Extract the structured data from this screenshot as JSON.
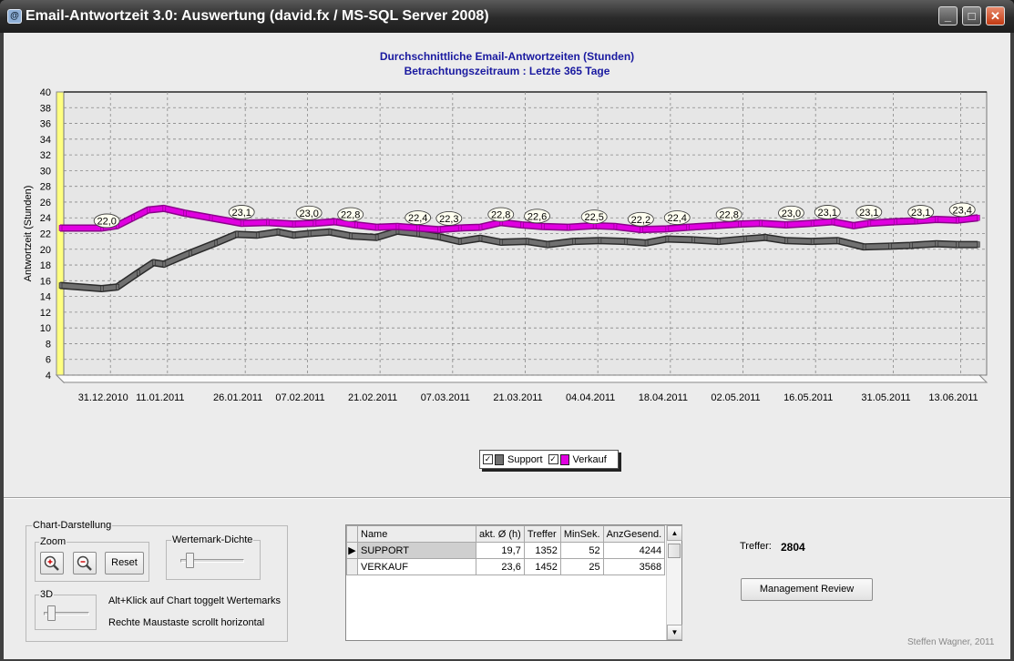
{
  "window": {
    "title": "Email-Antwortzeit 3.0: Auswertung (david.fx / MS-SQL Server 2008)",
    "controls": {
      "minimize": "_",
      "maximize": "□",
      "close": "✕"
    }
  },
  "chart_data": {
    "type": "line",
    "title": "Durchschnittliche Email-Antwortzeiten (Stunden)",
    "subtitle": "Betrachtungszeitraum : Letzte 365 Tage",
    "ylabel": "Antwortzeit (Stunden)",
    "ylim": [
      4,
      40
    ],
    "yticks": [
      4,
      6,
      8,
      10,
      12,
      14,
      16,
      18,
      20,
      22,
      24,
      26,
      28,
      30,
      32,
      34,
      36,
      38,
      40
    ],
    "xlim": [
      "2010-12-22",
      "2011-06-18"
    ],
    "xticks": [
      {
        "date": "2010-12-31",
        "label": "31.12.2010"
      },
      {
        "date": "2011-01-11",
        "label": "11.01.2011"
      },
      {
        "date": "2011-01-26",
        "label": "26.01.2011"
      },
      {
        "date": "2011-02-07",
        "label": "07.02.2011"
      },
      {
        "date": "2011-02-21",
        "label": "21.02.2011"
      },
      {
        "date": "2011-03-07",
        "label": "07.03.2011"
      },
      {
        "date": "2011-03-21",
        "label": "21.03.2011"
      },
      {
        "date": "2011-04-04",
        "label": "04.04.2011"
      },
      {
        "date": "2011-04-18",
        "label": "18.04.2011"
      },
      {
        "date": "2011-05-02",
        "label": "02.05.2011"
      },
      {
        "date": "2011-05-16",
        "label": "16.05.2011"
      },
      {
        "date": "2011-05-31",
        "label": "31.05.2011"
      },
      {
        "date": "2011-06-13",
        "label": "13.06.2011"
      }
    ],
    "grid": true,
    "legend_position": "bottom-center",
    "series": [
      {
        "name": "Support",
        "color": "#707070",
        "points": [
          [
            "2010-12-22",
            15.4
          ],
          [
            "2010-12-30",
            15.0
          ],
          [
            "2011-01-02",
            15.2
          ],
          [
            "2011-01-06",
            17.0
          ],
          [
            "2011-01-09",
            18.3
          ],
          [
            "2011-01-11",
            18.1
          ],
          [
            "2011-01-16",
            19.5
          ],
          [
            "2011-01-21",
            20.8
          ],
          [
            "2011-01-25",
            21.9
          ],
          [
            "2011-01-29",
            21.8
          ],
          [
            "2011-02-02",
            22.2
          ],
          [
            "2011-02-05",
            21.8
          ],
          [
            "2011-02-08",
            22.0
          ],
          [
            "2011-02-12",
            22.2
          ],
          [
            "2011-02-16",
            21.7
          ],
          [
            "2011-02-21",
            21.5
          ],
          [
            "2011-02-25",
            22.3
          ],
          [
            "2011-03-01",
            22.0
          ],
          [
            "2011-03-05",
            21.6
          ],
          [
            "2011-03-09",
            21.0
          ],
          [
            "2011-03-13",
            21.4
          ],
          [
            "2011-03-17",
            20.9
          ],
          [
            "2011-03-22",
            21.0
          ],
          [
            "2011-03-26",
            20.6
          ],
          [
            "2011-03-31",
            21.0
          ],
          [
            "2011-04-05",
            21.1
          ],
          [
            "2011-04-10",
            21.0
          ],
          [
            "2011-04-14",
            20.8
          ],
          [
            "2011-04-18",
            21.3
          ],
          [
            "2011-04-23",
            21.2
          ],
          [
            "2011-04-28",
            21.0
          ],
          [
            "2011-05-03",
            21.3
          ],
          [
            "2011-05-07",
            21.5
          ],
          [
            "2011-05-11",
            21.1
          ],
          [
            "2011-05-16",
            21.0
          ],
          [
            "2011-05-21",
            21.1
          ],
          [
            "2011-05-26",
            20.3
          ],
          [
            "2011-05-31",
            20.4
          ],
          [
            "2011-06-04",
            20.5
          ],
          [
            "2011-06-09",
            20.7
          ],
          [
            "2011-06-13",
            20.6
          ],
          [
            "2011-06-17",
            20.6
          ]
        ]
      },
      {
        "name": "Verkauf",
        "color": "#e000e0",
        "points": [
          [
            "2010-12-22",
            22.7
          ],
          [
            "2010-12-30",
            22.7
          ],
          [
            "2011-01-02",
            23.0
          ],
          [
            "2011-01-05",
            24.0
          ],
          [
            "2011-01-08",
            25.0
          ],
          [
            "2011-01-11",
            25.2
          ],
          [
            "2011-01-15",
            24.6
          ],
          [
            "2011-01-20",
            24.0
          ],
          [
            "2011-01-26",
            23.3
          ],
          [
            "2011-01-31",
            23.4
          ],
          [
            "2011-02-05",
            23.2
          ],
          [
            "2011-02-09",
            23.3
          ],
          [
            "2011-02-13",
            23.5
          ],
          [
            "2011-02-17",
            23.1
          ],
          [
            "2011-02-21",
            22.8
          ],
          [
            "2011-02-25",
            22.9
          ],
          [
            "2011-03-01",
            22.7
          ],
          [
            "2011-03-05",
            22.5
          ],
          [
            "2011-03-09",
            22.7
          ],
          [
            "2011-03-13",
            22.8
          ],
          [
            "2011-03-17",
            23.4
          ],
          [
            "2011-03-21",
            23.1
          ],
          [
            "2011-03-25",
            22.9
          ],
          [
            "2011-03-30",
            22.8
          ],
          [
            "2011-04-04",
            23.0
          ],
          [
            "2011-04-08",
            22.9
          ],
          [
            "2011-04-13",
            22.5
          ],
          [
            "2011-04-18",
            22.6
          ],
          [
            "2011-04-22",
            22.8
          ],
          [
            "2011-04-27",
            23.0
          ],
          [
            "2011-05-02",
            23.2
          ],
          [
            "2011-05-06",
            23.3
          ],
          [
            "2011-05-11",
            23.1
          ],
          [
            "2011-05-16",
            23.3
          ],
          [
            "2011-05-20",
            23.5
          ],
          [
            "2011-05-24",
            23.0
          ],
          [
            "2011-05-27",
            23.3
          ],
          [
            "2011-06-01",
            23.5
          ],
          [
            "2011-06-05",
            23.6
          ],
          [
            "2011-06-09",
            23.8
          ],
          [
            "2011-06-13",
            23.7
          ],
          [
            "2011-06-17",
            24.0
          ]
        ]
      }
    ],
    "annotations": [
      {
        "date": "2010-12-31",
        "value": 22.0,
        "label": "22,0"
      },
      {
        "date": "2011-01-26",
        "value": 23.1,
        "label": "23,1"
      },
      {
        "date": "2011-02-08",
        "value": 23.0,
        "label": "23,0"
      },
      {
        "date": "2011-02-16",
        "value": 22.8,
        "label": "22,8"
      },
      {
        "date": "2011-03-01",
        "value": 22.4,
        "label": "22,4"
      },
      {
        "date": "2011-03-07",
        "value": 22.3,
        "label": "22,3"
      },
      {
        "date": "2011-03-17",
        "value": 22.8,
        "label": "22,8"
      },
      {
        "date": "2011-03-24",
        "value": 22.6,
        "label": "22,6"
      },
      {
        "date": "2011-04-04",
        "value": 22.5,
        "label": "22,5"
      },
      {
        "date": "2011-04-13",
        "value": 22.2,
        "label": "22,2"
      },
      {
        "date": "2011-04-20",
        "value": 22.4,
        "label": "22,4"
      },
      {
        "date": "2011-04-30",
        "value": 22.8,
        "label": "22,8"
      },
      {
        "date": "2011-05-12",
        "value": 23.0,
        "label": "23,0"
      },
      {
        "date": "2011-05-19",
        "value": 23.1,
        "label": "23,1"
      },
      {
        "date": "2011-05-27",
        "value": 23.1,
        "label": "23,1"
      },
      {
        "date": "2011-06-06",
        "value": 23.1,
        "label": "23,1"
      },
      {
        "date": "2011-06-14",
        "value": 23.4,
        "label": "23,4"
      }
    ]
  },
  "legend": {
    "items": [
      {
        "label": "Support",
        "color": "#707070",
        "checked": "✓"
      },
      {
        "label": "Verkauf",
        "color": "#e000e0",
        "checked": "✓"
      }
    ]
  },
  "controls": {
    "chart_group": "Chart-Darstellung",
    "zoom_group": "Zoom",
    "zoom_in_icon": "zoom-in-icon",
    "zoom_out_icon": "zoom-out-icon",
    "reset": "Reset",
    "density_group": "Wertemark-Dichte",
    "density_level": 0.1,
    "threed_group": "3D",
    "threed_level": 0.1,
    "hint1": "Alt+Klick auf Chart toggelt Wertemarks",
    "hint2": "Rechte Maustaste scrollt horizontal"
  },
  "table": {
    "columns": [
      "Name",
      "akt. Ø (h)",
      "Treffer",
      "MinSek.",
      "AnzGesend."
    ],
    "current_row_marker": "▶",
    "rows": [
      {
        "name": "SUPPORT",
        "avg": "19,7",
        "hits": "1352",
        "minsec": "52",
        "sent": "4244"
      },
      {
        "name": "VERKAUF",
        "avg": "23,6",
        "hits": "1452",
        "minsec": "25",
        "sent": "3568"
      }
    ]
  },
  "summary": {
    "treffer_label": "Treffer:",
    "treffer_value": "2804",
    "management_button": "Management Review",
    "footer": "Steffen Wagner, 2011"
  }
}
